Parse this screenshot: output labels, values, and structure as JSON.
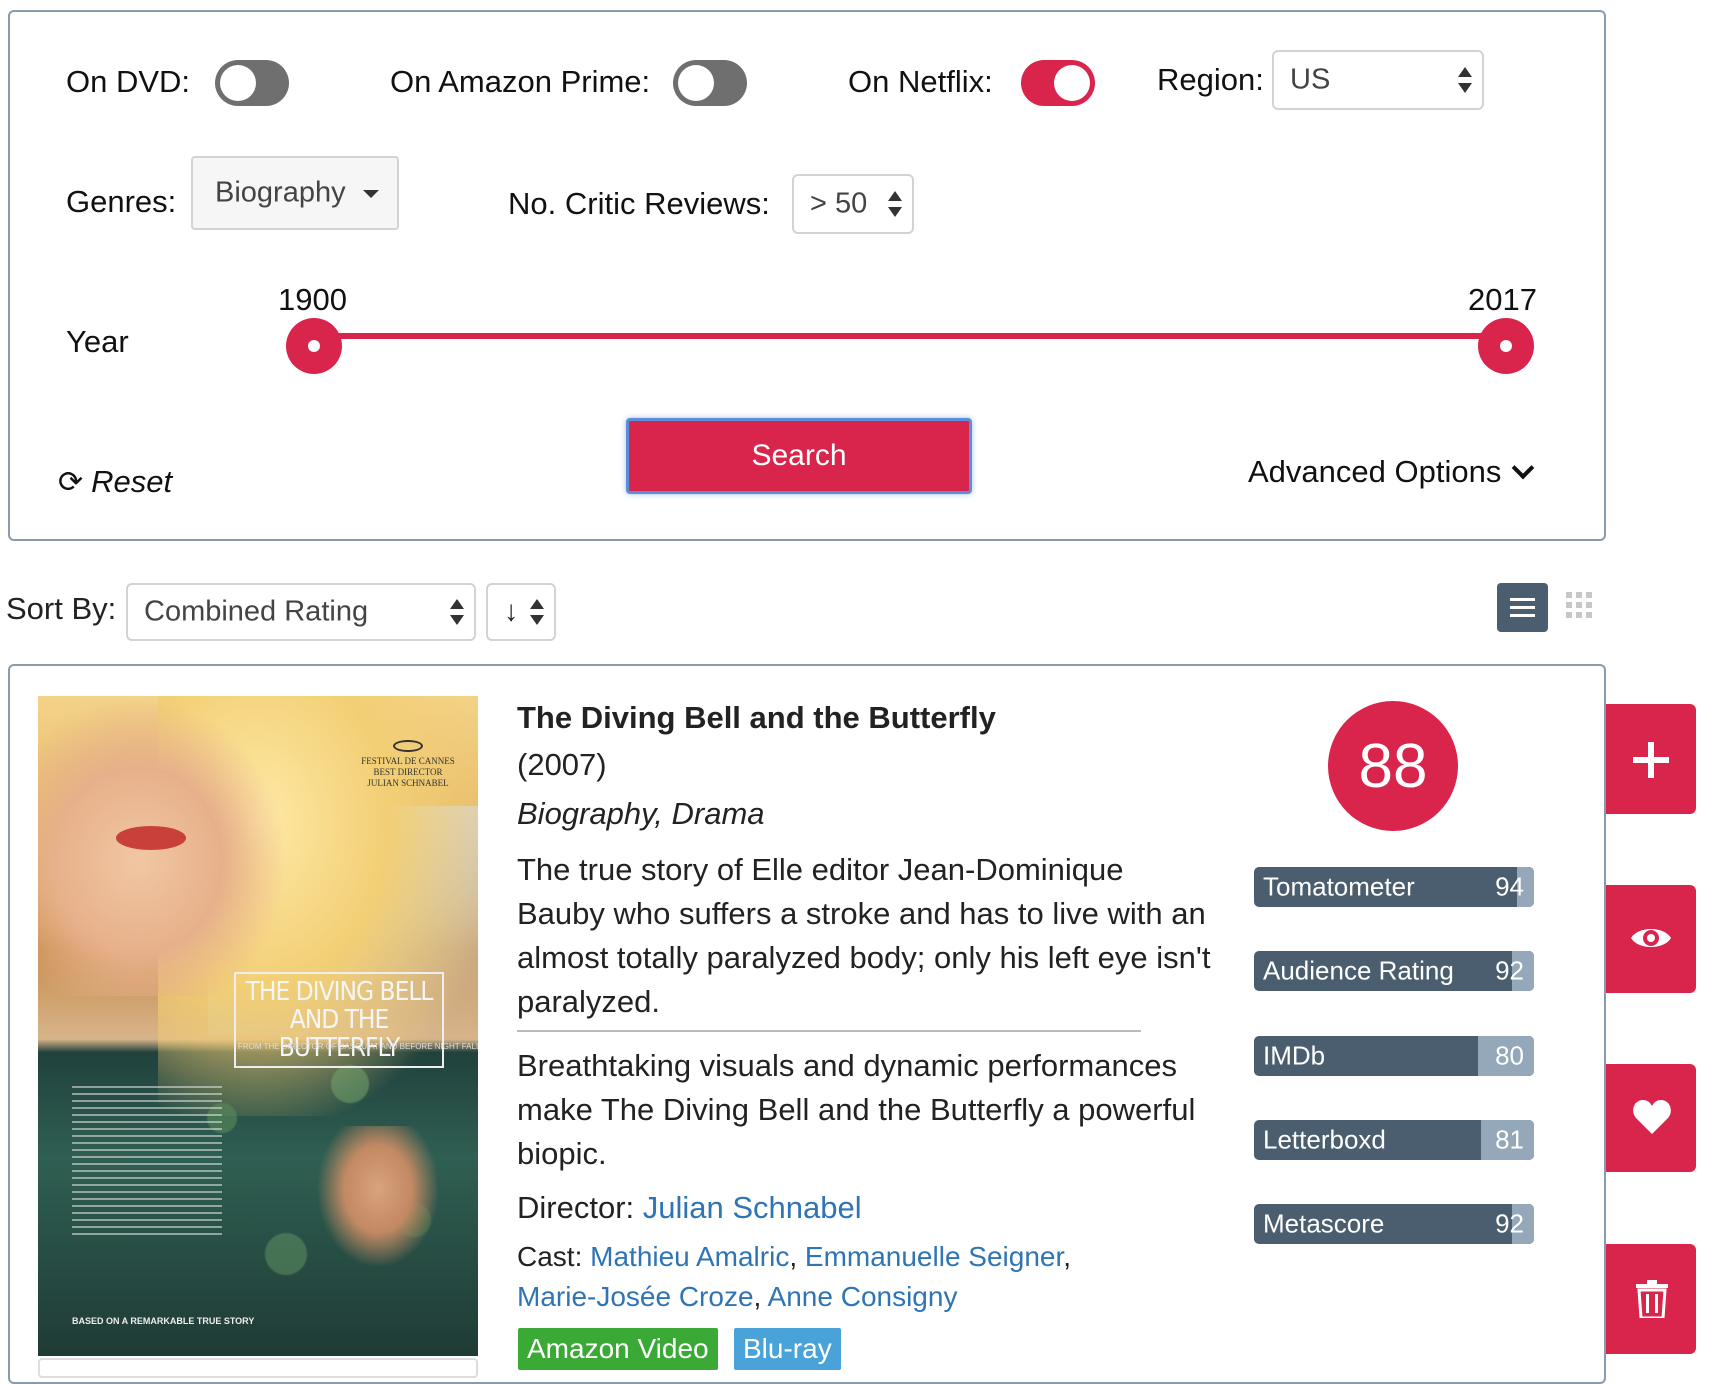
{
  "filters": {
    "dvd_label": "On DVD:",
    "dvd_on": false,
    "prime_label": "On Amazon Prime:",
    "prime_on": false,
    "netflix_label": "On Netflix:",
    "netflix_on": true,
    "region_label": "Region:",
    "region_value": "US",
    "genres_label": "Genres:",
    "genres_value": "Biography",
    "critic_label": "No. Critic Reviews:",
    "critic_value": "> 50",
    "year_label": "Year",
    "year_min": "1900",
    "year_max": "2017",
    "search_label": "Search",
    "reset_label": "Reset",
    "advanced_label": "Advanced Options"
  },
  "sort": {
    "label": "Sort By:",
    "value": "Combined Rating",
    "direction": "↓"
  },
  "movie": {
    "title": "The Diving Bell and the Butterfly",
    "year": "(2007)",
    "genres": "Biography, Drama",
    "plot": "The true story of Elle editor Jean-Dominique Bauby who suffers a stroke and has to live with an almost totally paralyzed body; only his left eye isn't paralyzed.",
    "consensus": "Breathtaking visuals and dynamic performances make The Diving Bell and the Butterfly a powerful biopic.",
    "director_label": "Director:",
    "director": "Julian Schnabel",
    "cast_label": "Cast:",
    "cast": [
      "Mathieu Amalric",
      "Emmanuelle Seigner",
      "Marie-Josée Croze",
      "Anne Consigny"
    ],
    "combined_score": "88",
    "ratings": [
      {
        "name": "Tomatometer",
        "value": "94"
      },
      {
        "name": "Audience Rating",
        "value": "92"
      },
      {
        "name": "IMDb",
        "value": "80"
      },
      {
        "name": "Letterboxd",
        "value": "81"
      },
      {
        "name": "Metascore",
        "value": "92"
      }
    ],
    "availability": [
      {
        "label": "Amazon Video",
        "color": "#3aa935"
      },
      {
        "label": "Blu-ray",
        "color": "#4aa3d8"
      }
    ],
    "poster": {
      "title_text": "THE DIVING BELL AND THE BUTTERFLY",
      "fest_text": "FESTIVAL DE CANNES BEST DIRECTOR JULIAN SCHNABEL",
      "tagline": "FROM THE DIRECTOR OF BASQUIAT AND BEFORE NIGHT FALLS",
      "based_on": "BASED ON A REMARKABLE TRUE STORY"
    }
  },
  "colors": {
    "accent": "#d9244c",
    "bar": "#4a5e70",
    "bar_fill": "#94a8ba",
    "link": "#2f74b5"
  },
  "icons": {
    "reset": "refresh-icon",
    "advanced": "chevron-down-icon",
    "view_list": "list-view-icon",
    "view_grid": "grid-view-icon",
    "add": "plus-icon",
    "watch": "eye-icon",
    "favorite": "heart-icon",
    "delete": "trash-icon"
  }
}
